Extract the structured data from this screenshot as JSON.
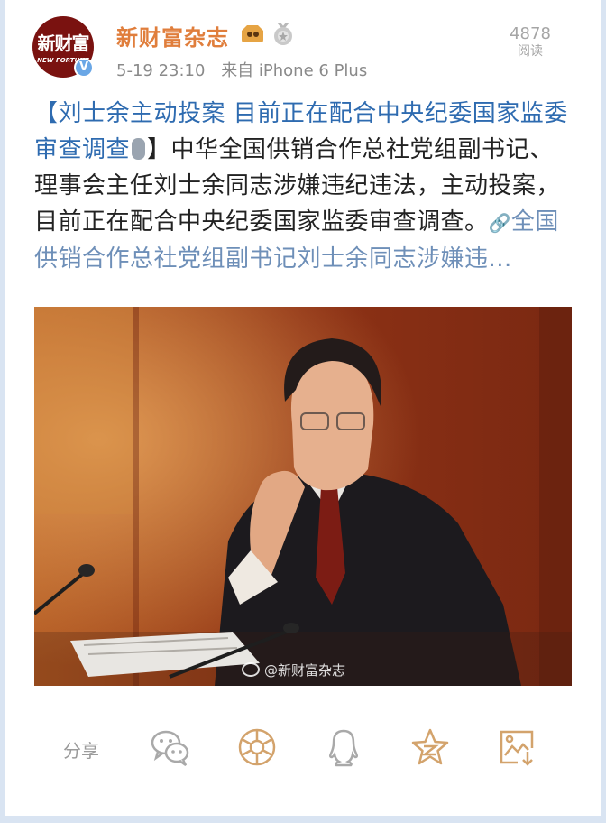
{
  "account": {
    "avatar_text_cn": "新财富",
    "avatar_text_en": "NEW FORTUNE",
    "verified_mark": "V",
    "username": "新财富杂志",
    "timestamp": "5-19 23:10",
    "source": "来自 iPhone 6 Plus",
    "read_count": "4878",
    "read_label": "阅读"
  },
  "post": {
    "topic_text": "【刘士余主动投案 目前正在配合中央纪委国家监委审查调查",
    "body_text": "】中华全国供销合作总社党组副书记、理事会主任刘士余同志涉嫌违纪违法，主动投案，目前正在配合中央纪委国家监委审查调查。",
    "link_text": "全国供销合作总社党组副书记刘士余同志涉嫌违...",
    "image_watermark": "@新财富杂志"
  },
  "share_bar": {
    "label": "分享",
    "icons": [
      "wechat-icon",
      "moments-icon",
      "qq-icon",
      "qzone-star-icon",
      "save-image-icon"
    ]
  },
  "colors": {
    "username": "#e07e3c",
    "topic": "#2e6bb0",
    "link": "#6e8fb8",
    "photo_bg": "#8a3518",
    "accent_share": "#d3a36c"
  }
}
